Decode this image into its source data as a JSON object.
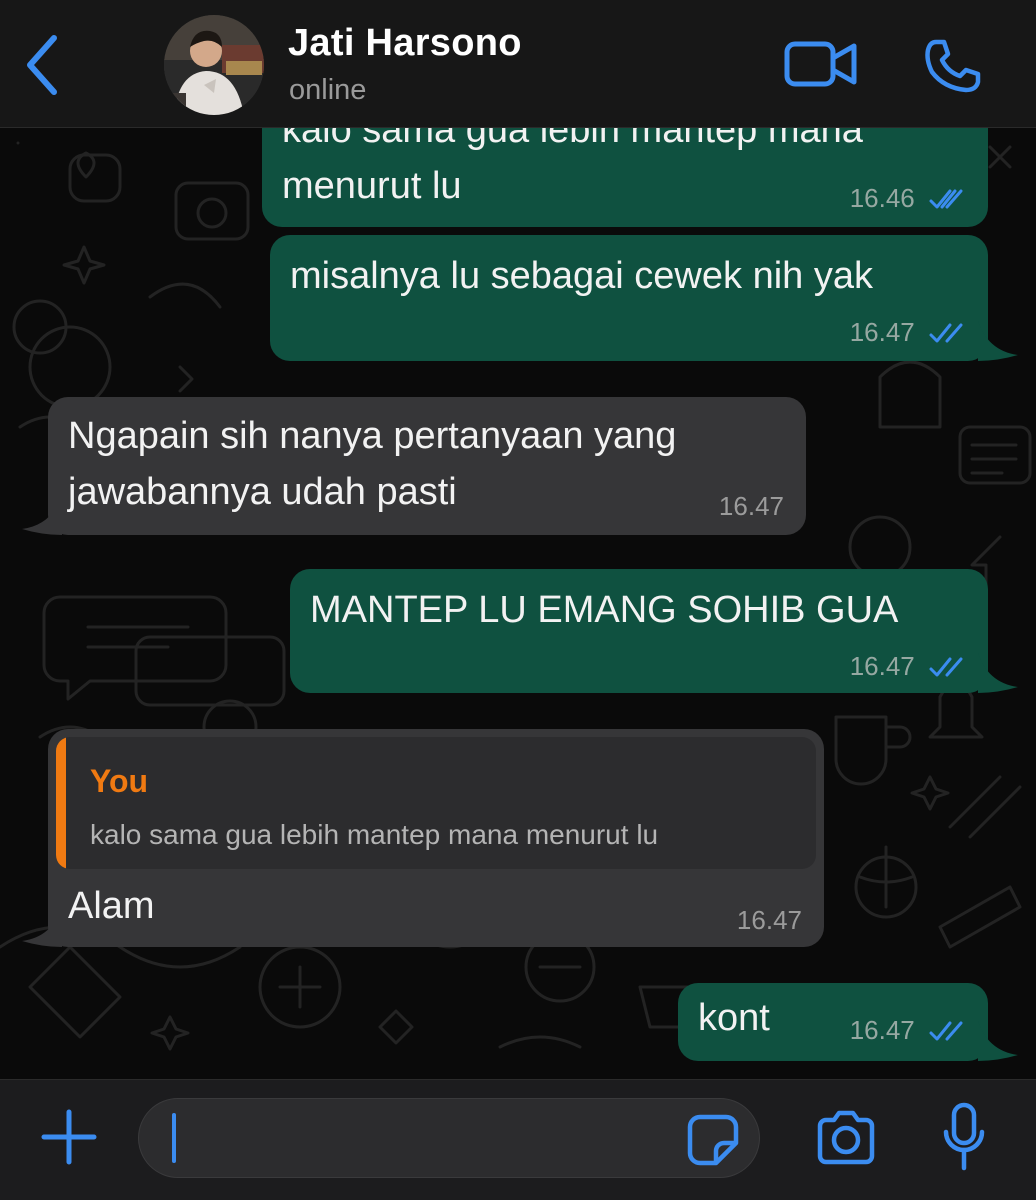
{
  "header": {
    "contact_name": "Jati Harsono",
    "status": "online",
    "icons": [
      "chevron-left-icon",
      "video-camera-icon",
      "phone-icon"
    ],
    "accent_color": "#3b8cf0"
  },
  "messages": [
    {
      "direction": "outgoing",
      "lines": [
        "kalo sama gua lebih mantep mana",
        "menurut lu"
      ],
      "time": "16.46",
      "status": "read"
    },
    {
      "direction": "outgoing",
      "lines": [
        "misalnya lu sebagai cewek nih yak"
      ],
      "time": "16.47",
      "status": "read"
    },
    {
      "direction": "incoming",
      "lines": [
        "Ngapain sih nanya pertanyaan yang",
        "jawabannya udah pasti"
      ],
      "time": "16.47"
    },
    {
      "direction": "outgoing",
      "lines": [
        "MANTEP LU EMANG SOHIB GUA"
      ],
      "time": "16.47",
      "status": "read"
    },
    {
      "direction": "incoming",
      "reply_to": {
        "author": "You",
        "text": "kalo sama gua lebih mantep mana menurut lu"
      },
      "lines": [
        "Alam"
      ],
      "time": "16.47"
    },
    {
      "direction": "outgoing",
      "lines": [
        "kont"
      ],
      "time": "16.47",
      "status": "read"
    }
  ],
  "composer": {
    "value": "",
    "icons": [
      "plus-icon",
      "sticker-icon",
      "camera-icon",
      "microphone-icon"
    ]
  },
  "colors": {
    "outgoing_bubble": "#0f5140",
    "incoming_bubble": "#363638",
    "read_ticks": "#3b8cf0",
    "quote_accent": "#f07a12"
  }
}
